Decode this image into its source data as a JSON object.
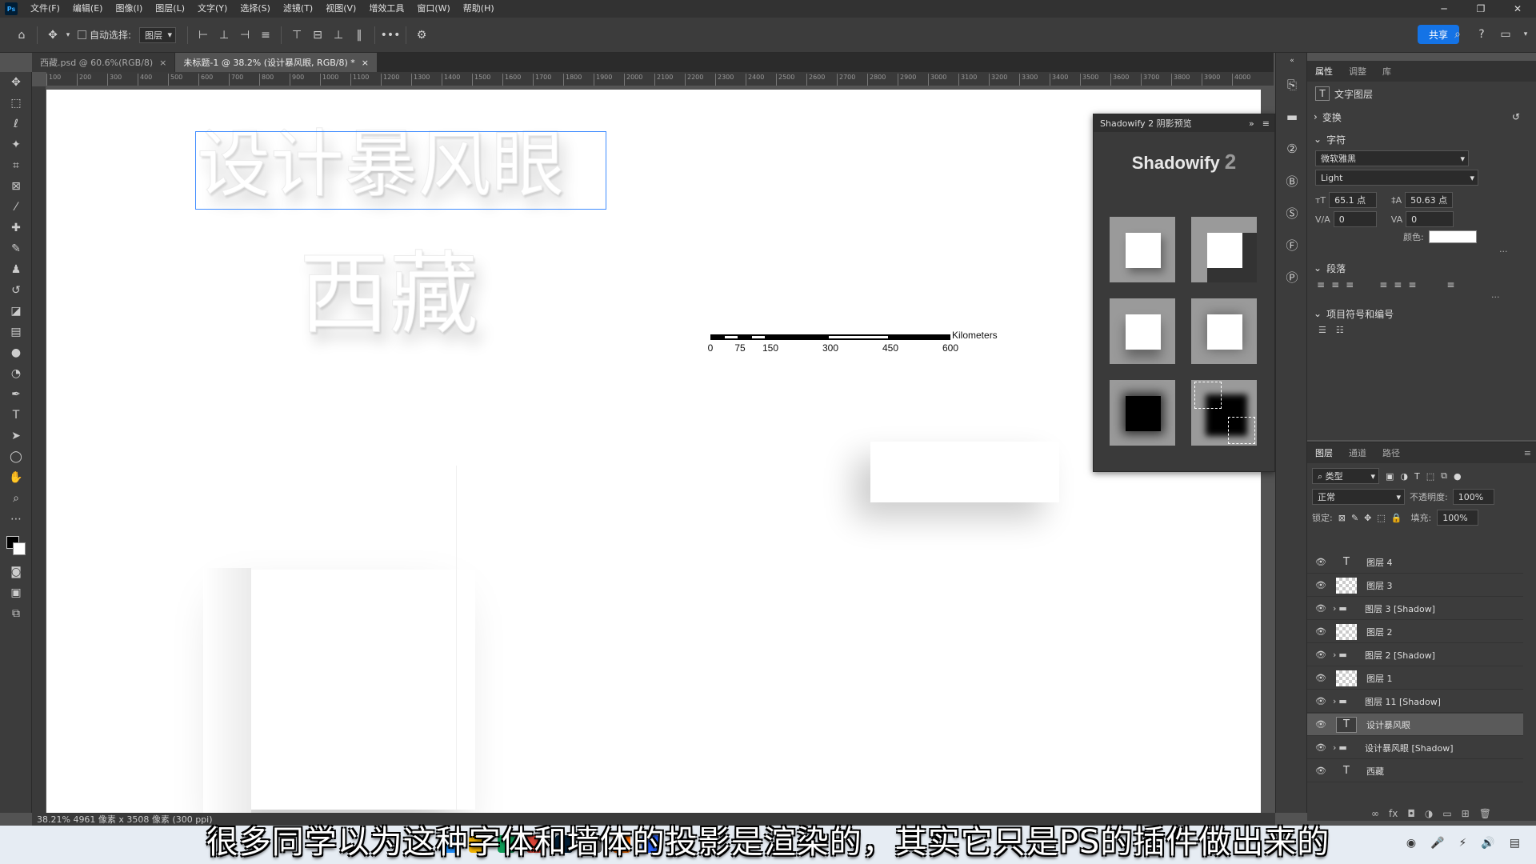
{
  "menubar": {
    "app_icon": "Ps",
    "items": [
      "文件(F)",
      "编辑(E)",
      "图像(I)",
      "图层(L)",
      "文字(Y)",
      "选择(S)",
      "滤镜(T)",
      "视图(V)",
      "增效工具",
      "窗口(W)",
      "帮助(H)"
    ]
  },
  "options": {
    "auto_select_label": "自动选择:",
    "auto_select_value": "图层",
    "more": "•••",
    "share": "共享"
  },
  "tabs": [
    {
      "label": "西藏.psd @ 60.6%(RGB/8)",
      "close": "×"
    },
    {
      "label": "未标题-1 @ 38.2% (设计暴风眼, RGB/8) *",
      "close": "×"
    }
  ],
  "ruler_ticks": [
    "100",
    "200",
    "300",
    "400",
    "500",
    "600",
    "700",
    "800",
    "900",
    "1000",
    "1100",
    "1200",
    "1300",
    "1400",
    "1500",
    "1600",
    "1700",
    "1800",
    "1900",
    "2000",
    "2100",
    "2200",
    "2300",
    "2400",
    "2500",
    "2600",
    "2700",
    "2800",
    "2900",
    "3000",
    "3100",
    "3200",
    "3300",
    "3400",
    "3500",
    "3600",
    "3700",
    "3800",
    "3900",
    "4000"
  ],
  "canvas": {
    "headline": "设计暴风眼",
    "subhead": "西藏",
    "scale_bar": {
      "unit": "Kilometers",
      "labels": [
        "0",
        "75",
        "150",
        "300",
        "450",
        "600"
      ]
    }
  },
  "shadowify": {
    "title": "Shadowify 2 阴影预览",
    "logo": "Shadowify",
    "logo_num": "2"
  },
  "properties": {
    "tabs": [
      "属性",
      "调整",
      "库"
    ],
    "layer_type": "文字图层",
    "transform": "变换",
    "character": "字符",
    "font_family": "微软雅黑",
    "font_style": "Light",
    "font_size": "65.1 点",
    "leading": "50.63 点",
    "kerning": "0",
    "tracking": "0",
    "color_label": "颜色:",
    "text_color": "#ffffff",
    "paragraph": "段落",
    "bullets": "项目符号和编号"
  },
  "layers": {
    "tabs": [
      "图层",
      "通道",
      "路径"
    ],
    "filter_label": "类型",
    "blend_mode": "正常",
    "opacity_label": "不透明度:",
    "opacity": "100%",
    "lock_label": "锁定:",
    "fill_label": "填充:",
    "fill": "100%",
    "items": [
      {
        "name": "图层 4",
        "kind": "text"
      },
      {
        "name": "图层 3",
        "kind": "pixel"
      },
      {
        "name": "图层 3 [Shadow]",
        "kind": "group"
      },
      {
        "name": "图层 2",
        "kind": "pixel"
      },
      {
        "name": "图层 2 [Shadow]",
        "kind": "group"
      },
      {
        "name": "图层 1",
        "kind": "pixel"
      },
      {
        "name": "图层 11 [Shadow]",
        "kind": "group"
      },
      {
        "name": "设计暴风眼",
        "kind": "text",
        "selected": true
      },
      {
        "name": "设计暴风眼 [Shadow]",
        "kind": "group"
      },
      {
        "name": "西藏",
        "kind": "text"
      }
    ]
  },
  "statusbar": {
    "text": "38.21%    4961 像素 x 3508 像素 (300 ppi)"
  },
  "subtitle": "很多同学以为这种字体和墙体的投影是渲染的，其实它只是PS的插件做出来的",
  "colors": {
    "accent": "#1473e6",
    "selection": "#3f8cff"
  }
}
